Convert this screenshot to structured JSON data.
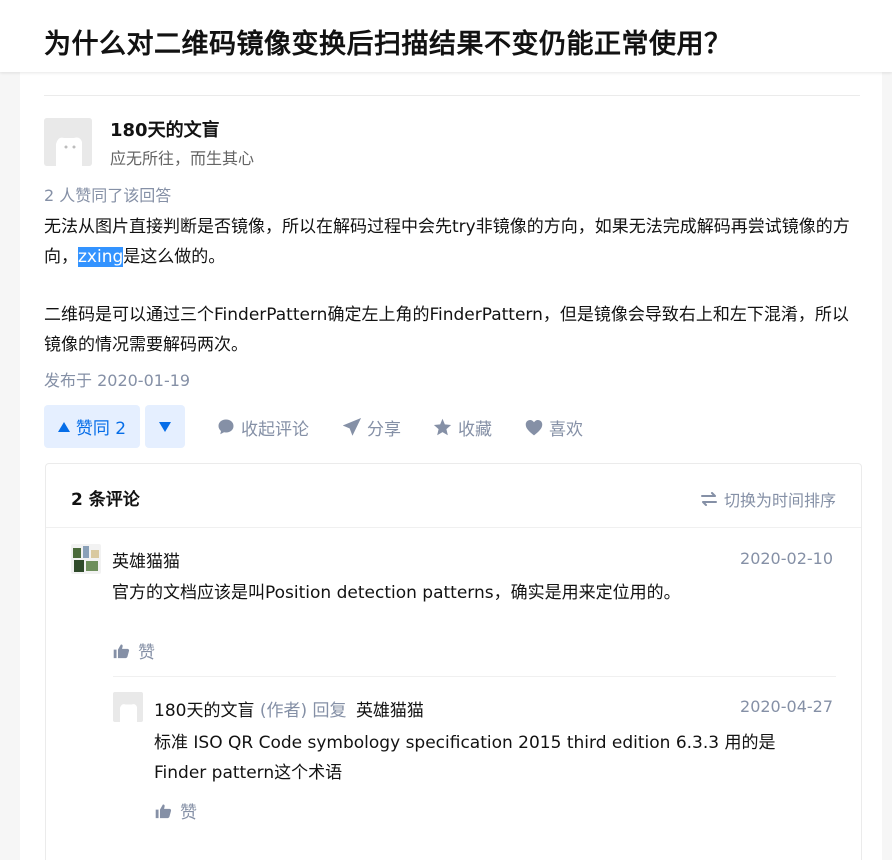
{
  "question": {
    "title": "为什么对二维码镜像变换后扫描结果不变仍能正常使用？"
  },
  "answer": {
    "author_name": "180天的文盲",
    "author_bio": "应无所往，而生其心",
    "voters_text": "2 人赞同了该回答",
    "content": {
      "p1_before": "无法从图片直接判断是否镜像，所以在解码过程中会先try非镜像的方向，如果无法完成解码再尝试镜像的方向，",
      "p1_highlight": "zxing",
      "p1_after": "是这么做的。",
      "p2": "二维码是可以通过三个FinderPattern确定左上角的FinderPattern，但是镜像会导致右上和左下混淆，所以镜像的情况需要解码两次。"
    },
    "publish_time": "发布于 2020-01-19"
  },
  "actions": {
    "vote_up_label": "赞同 2",
    "collapse_comments": "收起评论",
    "share": "分享",
    "favorite": "收藏",
    "like": "喜欢"
  },
  "comments": {
    "count_label": "2 条评论",
    "sort_label": "切换为时间排序",
    "items": [
      {
        "author": "英雄猫猫",
        "date": "2020-02-10",
        "text": "官方的文档应该是叫Position detection patterns，确实是用来定位用的。",
        "like_label": "赞"
      },
      {
        "author": "180天的文盲",
        "author_tag": "(作者)",
        "reply_word": "回复",
        "reply_to": "英雄猫猫",
        "date": "2020-04-27",
        "text_line1": "标准 ISO QR Code symbology specification 2015 third edition 6.3.3 用的是",
        "text_line2": "Finder pattern这个术语",
        "like_label": "赞"
      }
    ]
  },
  "colors": {
    "brand_blue": "#056de8",
    "vote_bg": "#e5efff",
    "muted": "#8590a6",
    "highlight": "#3393ff"
  }
}
